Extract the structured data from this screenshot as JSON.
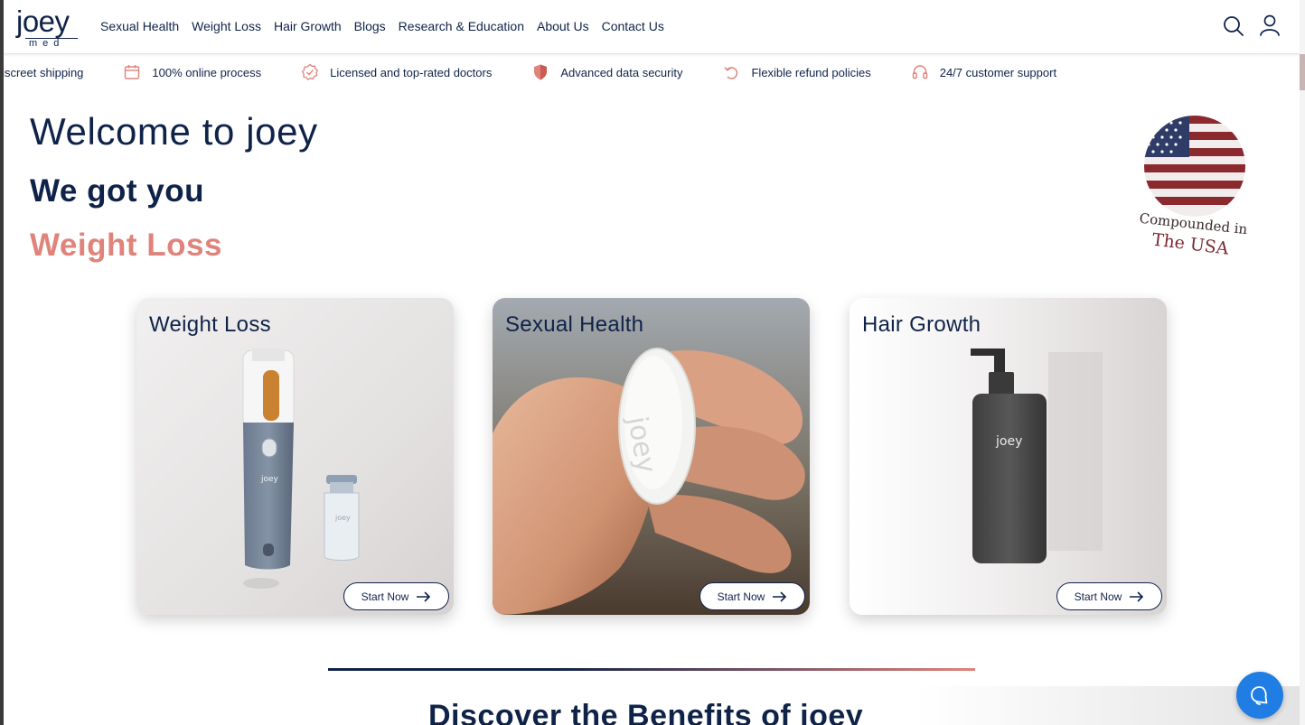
{
  "header": {
    "logo_word": "joey",
    "logo_sub": "med",
    "nav": [
      "Sexual Health",
      "Weight Loss",
      "Hair Growth",
      "Blogs",
      "Research & Education",
      "About Us",
      "Contact Us"
    ],
    "icons": [
      "search-icon",
      "user-icon"
    ]
  },
  "ticker": [
    {
      "label": "d discreet shipping",
      "icon": "none"
    },
    {
      "label": "100% online process",
      "icon": "calendar-icon"
    },
    {
      "label": "Licensed and top-rated doctors",
      "icon": "verified-badge-icon"
    },
    {
      "label": "Advanced data security",
      "icon": "shield-icon"
    },
    {
      "label": "Flexible refund policies",
      "icon": "refund-icon"
    },
    {
      "label": "24/7 customer support",
      "icon": "headset-icon"
    }
  ],
  "hero": {
    "welcome": "Welcome to joey",
    "got_you": "We got you",
    "rotating": "Weight Loss"
  },
  "badge": {
    "line1": "Compounded in",
    "line2": "The USA"
  },
  "cards": [
    {
      "title": "Weight Loss",
      "button": "Start Now",
      "pen_brand": "joey",
      "vial_brand": "joey"
    },
    {
      "title": "Sexual Health",
      "button": "Start Now",
      "pill_brand": "joey"
    },
    {
      "title": "Hair Growth",
      "button": "Start Now",
      "bottle_brand": "joey"
    }
  ],
  "discover_heading": "Discover the Benefits of joey",
  "colors": {
    "navy": "#0f2349",
    "coral": "#e0837b",
    "chat_blue": "#1f7de4"
  }
}
